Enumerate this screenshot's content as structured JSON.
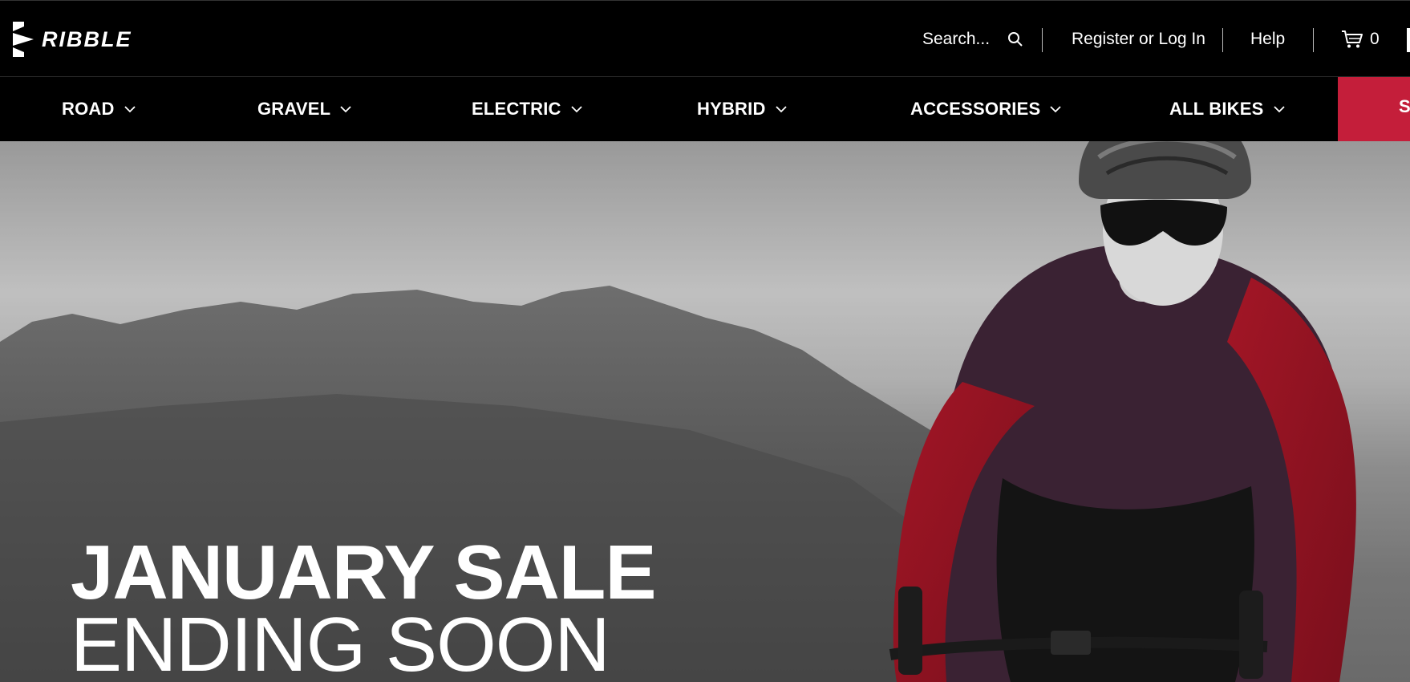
{
  "header": {
    "brand": "RIBBLE",
    "search": {
      "placeholder": "Search..."
    },
    "register_login": "Register or Log In",
    "help": "Help",
    "cart": {
      "count": "0"
    }
  },
  "nav": {
    "items": [
      {
        "label": "ROAD"
      },
      {
        "label": "GRAVEL"
      },
      {
        "label": "ELECTRIC"
      },
      {
        "label": "HYBRID"
      },
      {
        "label": "ACCESSORIES"
      },
      {
        "label": "ALL BIKES"
      }
    ],
    "sale_label": "S"
  },
  "hero": {
    "title": "JANUARY SALE",
    "subtitle": "ENDING SOON"
  },
  "colors": {
    "accent": "#c41e3a",
    "background": "#000000",
    "text": "#ffffff"
  },
  "icons": {
    "logo": "ribble-logo-icon",
    "search": "search-icon",
    "cart": "cart-icon",
    "chevron": "chevron-down-icon"
  }
}
